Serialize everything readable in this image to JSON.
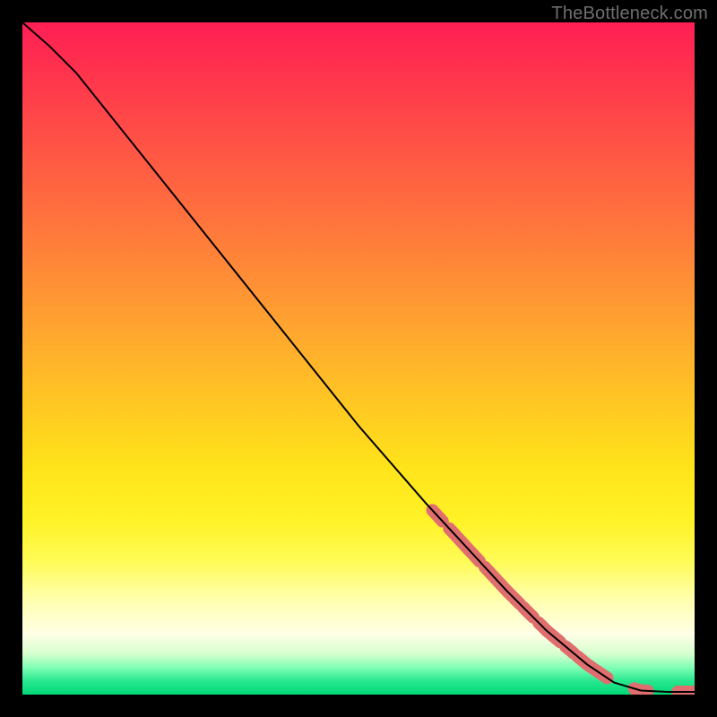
{
  "watermark": "TheBottleneck.com",
  "chart_data": {
    "type": "line",
    "title": "",
    "xlabel": "",
    "ylabel": "",
    "xlim": [
      0,
      100
    ],
    "ylim": [
      0,
      100
    ],
    "curve": {
      "name": "bottleneck-curve",
      "color": "#000000",
      "stroke_width": 2,
      "points": [
        {
          "x": 0,
          "y": 100
        },
        {
          "x": 4,
          "y": 96.5
        },
        {
          "x": 8,
          "y": 92.5
        },
        {
          "x": 12,
          "y": 87.5
        },
        {
          "x": 20,
          "y": 77.5
        },
        {
          "x": 30,
          "y": 65
        },
        {
          "x": 40,
          "y": 52.5
        },
        {
          "x": 50,
          "y": 40
        },
        {
          "x": 60,
          "y": 28.5
        },
        {
          "x": 66,
          "y": 22
        },
        {
          "x": 72,
          "y": 15.5
        },
        {
          "x": 78,
          "y": 9.5
        },
        {
          "x": 84,
          "y": 4.5
        },
        {
          "x": 88,
          "y": 1.8
        },
        {
          "x": 92,
          "y": 0.6
        },
        {
          "x": 96,
          "y": 0.4
        },
        {
          "x": 100,
          "y": 0.4
        }
      ]
    },
    "markers": {
      "name": "highlighted-segments",
      "color": "#e06e6e",
      "radius": 7,
      "segments": [
        {
          "from_x": 61,
          "to_x": 62.5
        },
        {
          "from_x": 63.5,
          "to_x": 68
        },
        {
          "from_x": 68.8,
          "to_x": 74
        },
        {
          "from_x": 74.5,
          "to_x": 76
        },
        {
          "from_x": 76.8,
          "to_x": 80
        },
        {
          "from_x": 80.8,
          "to_x": 82
        },
        {
          "from_x": 82.6,
          "to_x": 87
        },
        {
          "from_x": 91,
          "to_x": 93
        },
        {
          "from_x": 97.5,
          "to_x": 100
        }
      ]
    }
  }
}
